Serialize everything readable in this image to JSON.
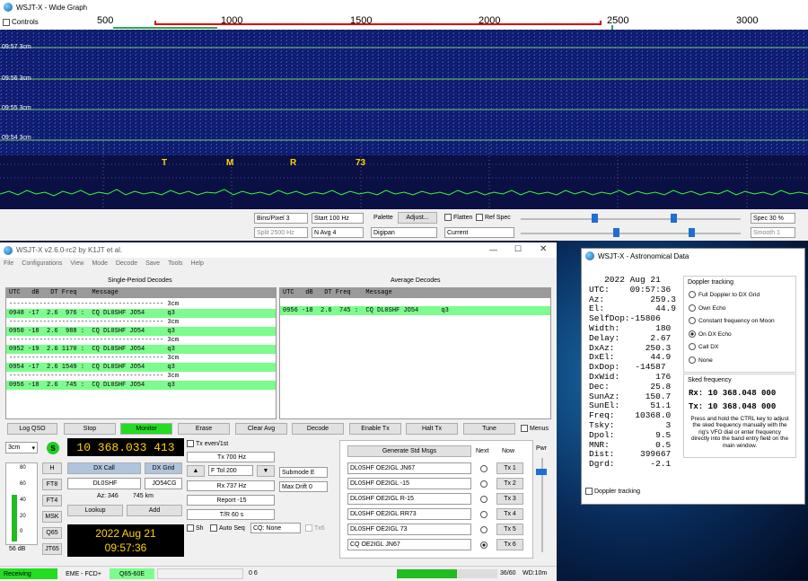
{
  "wide": {
    "title": "WSJT-X - Wide Graph",
    "controls_label": "Controls",
    "freq_labels": [
      "500",
      "1000",
      "1500",
      "2000",
      "2500",
      "3000"
    ],
    "time_labels": [
      "09:57  3cm",
      "09:56  3cm",
      "09:55  3cm",
      "09:54  3cm"
    ],
    "jt_letters": [
      "T",
      "M",
      "R",
      "73"
    ],
    "bins_pixel": "Bins/Pixel  3",
    "start": "Start 100 Hz",
    "split": "Split  2500  Hz",
    "navg": "N Avg 4",
    "palette": "Palette",
    "adjust": "Adjust...",
    "palette_value": "Digipan",
    "flatten": "Flatten",
    "ref_spec": "Ref Spec",
    "current": "Current",
    "spec": "Spec 30 %",
    "smooth": "Smooth  1"
  },
  "main": {
    "title": "WSJT-X   v2.6.0-rc2   by K1JT et al.",
    "menu": [
      "File",
      "Configurations",
      "View",
      "Mode",
      "Decode",
      "Save",
      "Tools",
      "Help"
    ],
    "single_title": "Single-Period Decodes",
    "average_title": "Average Decodes",
    "header": "UTC   dB   DT Freq    Message",
    "single_rows": [
      {
        "text": "----------------------------------------- 3cm",
        "g": false
      },
      {
        "text": "0948 -17  2.6  976 :  CQ DL0SHF JO54      q3",
        "g": true
      },
      {
        "text": "----------------------------------------- 3cm",
        "g": false
      },
      {
        "text": "0950 -18  2.6  988 :  CQ DL0SHF JO54      q3",
        "g": true
      },
      {
        "text": "----------------------------------------- 3cm",
        "g": false
      },
      {
        "text": "0952 -19  2.6 1170 :  CQ DL0SHF JO54      q3",
        "g": true
      },
      {
        "text": "----------------------------------------- 3cm",
        "g": false
      },
      {
        "text": "0954 -17  2.6 1549 :  CQ DL0SHF JO54      q3",
        "g": true
      },
      {
        "text": "----------------------------------------- 3cm",
        "g": false
      },
      {
        "text": "0956 -18  2.6  745 :  CQ DL0SHF JO54      q3",
        "g": true
      }
    ],
    "average_rows": [
      {
        "text": "0956 -18  2.6  745 :  CQ DL0SHF JO54      q3",
        "g": true
      }
    ],
    "buttons": [
      "Log QSO",
      "Stop",
      "Monitor",
      "Erase",
      "Clear Avg",
      "Decode",
      "Enable Tx",
      "Halt Tx",
      "Tune"
    ],
    "menus_label": "Menus",
    "band": "3cm",
    "s_label": "S",
    "freq_display": "10 368.033 413",
    "tx_even": "Tx even/1st",
    "tx_hz": "Tx  700  Hz",
    "ftol": "F Tol  200",
    "rx_hz": "Rx  737  Hz",
    "report": "Report -15",
    "tr": "T/R  60  s",
    "submode": "Submode E",
    "max_drift": "Max Drift  0",
    "sh": "Sh",
    "auto_seq": "Auto Seq",
    "cq_none": "CQ: None",
    "tx6_label": "Tx6",
    "mode_buttons": [
      "H",
      "FT8",
      "FT4",
      "MSK",
      "Q65",
      "JT65"
    ],
    "meter_ticks": [
      "80",
      "60",
      "40",
      "20",
      "0"
    ],
    "meter_db": "56 dB",
    "dx_call_btn": "DX Call",
    "dx_grid_btn": "DX Grid",
    "dx_call": "DL0SHF",
    "dx_grid": "JO54CG",
    "az": "Az: 346",
    "dist": "745 km",
    "lookup": "Lookup",
    "add": "Add",
    "date": "2022 Aug 21",
    "time": "09:57:36",
    "gen_std": "Generate Std Msgs",
    "next": "Next",
    "now": "Now",
    "pwr": "Pwr",
    "msgs": [
      "DL0SHF OE2IGL JN67",
      "DL0SHF OE2IGL -15",
      "DL0SHF OE2IGL R-15",
      "DL0SHF OE2IGL RR73",
      "DL0SHF OE2IGL 73",
      "CQ OE2IGL JN67"
    ],
    "tx_buttons": [
      "Tx 1",
      "Tx 2",
      "Tx 3",
      "Tx 4",
      "Tx 5",
      "Tx 6"
    ],
    "status": {
      "receiving": "Receiving",
      "mode": "EME - FCD+",
      "submode": "Q65-60E",
      "counter": "0  6",
      "progress": "36/60",
      "wd": "WD:10m"
    },
    "progress_fraction": 0.6
  },
  "astro": {
    "title": "WSJT-X - Astronomical Data",
    "lines": [
      "   2022 Aug 21",
      "UTC:    09:57:36",
      "Az:         259.3",
      "El:          44.9",
      "SelfDop:-15806",
      "Width:       180",
      "Delay:      2.67",
      "DxAz:      250.3",
      "DxEl:       44.9",
      "DxDop:   -14587",
      "DxWid:       176",
      "Dec:        25.8",
      "SunAz:     150.7",
      "SunEl:      51.1",
      "Freq:    10368.0",
      "Tsky:          3",
      "Dpol:        9.5",
      "MNR:         0.5",
      "Dist:     399667",
      "Dgrd:       -2.1"
    ],
    "doppler_title": "Doppler tracking",
    "doppler_options": [
      "Full Doppler to DX Grid",
      "Own Echo",
      "Constant frequency on Moon",
      "On DX Echo",
      "Call DX",
      "None"
    ],
    "doppler_selected": 3,
    "sked_title": "Sked frequency",
    "rx_sked": "Rx: 10 368.048 000",
    "tx_sked": "Tx: 10 368.048 000",
    "note": "Press and hold the CTRL key to adjust the sked frequency manually with the rig's VFO dial or enter frequency directly into the band entry field on the main window.",
    "doppler_chk": "Doppler tracking"
  },
  "colors": {
    "green": "#7CFC8C",
    "monitor": "#22dd22",
    "waterfall": "#0d1a6e",
    "display_bg": "#000",
    "display_fg": "#ffd400"
  }
}
